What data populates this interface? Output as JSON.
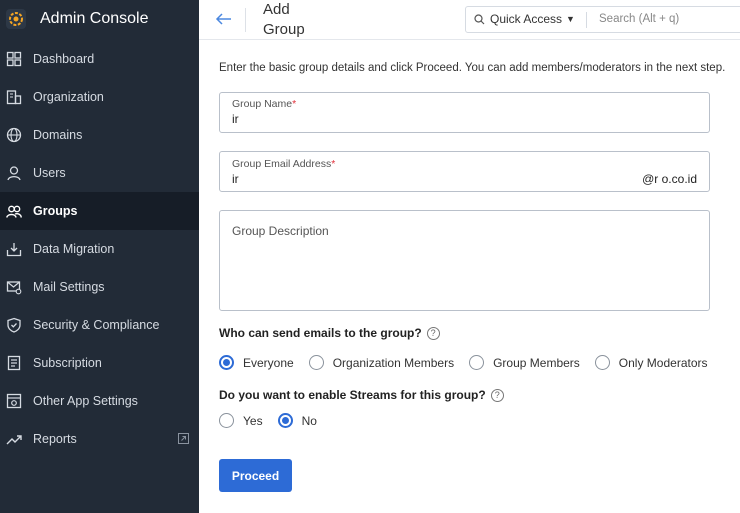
{
  "app": {
    "title": "Admin Console"
  },
  "sidebar": {
    "items": [
      {
        "label": "Dashboard",
        "icon": "dashboard-icon"
      },
      {
        "label": "Organization",
        "icon": "organization-icon"
      },
      {
        "label": "Domains",
        "icon": "globe-icon"
      },
      {
        "label": "Users",
        "icon": "user-icon"
      },
      {
        "label": "Groups",
        "icon": "group-icon",
        "active": true
      },
      {
        "label": "Data Migration",
        "icon": "migration-icon"
      },
      {
        "label": "Mail Settings",
        "icon": "mail-settings-icon"
      },
      {
        "label": "Security & Compliance",
        "icon": "shield-icon"
      },
      {
        "label": "Subscription",
        "icon": "subscription-icon"
      },
      {
        "label": "Other App Settings",
        "icon": "app-settings-icon"
      },
      {
        "label": "Reports",
        "icon": "reports-icon"
      }
    ]
  },
  "header": {
    "title": "Add Group",
    "quick_access": "Quick Access",
    "search_placeholder": "Search (Alt + q)"
  },
  "form": {
    "intro": "Enter the basic group details and click Proceed. You can add members/moderators in the next step.",
    "group_name_label": "Group Name",
    "group_name_value": "ir",
    "email_label": "Group Email Address",
    "email_value": "ir",
    "email_domain": "@r        o.co.id",
    "description_placeholder": "Group Description",
    "q_send": "Who can send emails to the group?",
    "send_options": [
      "Everyone",
      "Organization Members",
      "Group Members",
      "Only Moderators"
    ],
    "q_streams": "Do you want to enable Streams for this group?",
    "stream_options": [
      "Yes",
      "No"
    ],
    "proceed_label": "Proceed"
  },
  "colors": {
    "sidebar_bg": "#222b37",
    "accent": "#2d6bd6",
    "required": "#e0303a"
  }
}
